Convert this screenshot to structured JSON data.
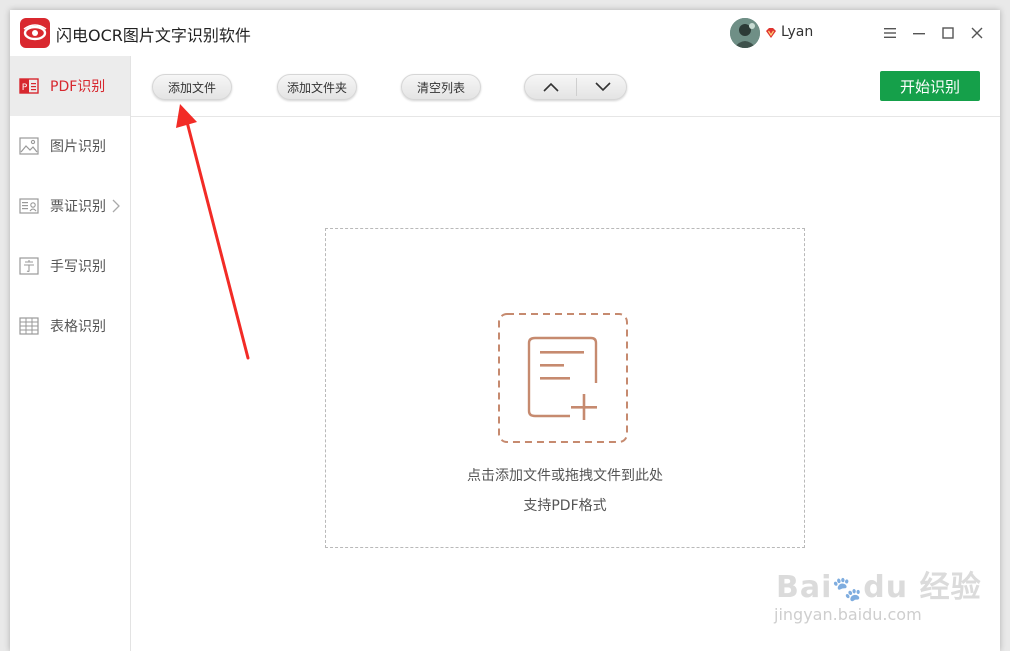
{
  "app": {
    "title": "闪电OCR图片文字识别软件",
    "username": "Lyan",
    "accent_color": "#d7282f",
    "primary_color": "#15a04a"
  },
  "window_controls": {
    "menu_icon": "hamburger-icon",
    "minimize_icon": "minimize-icon",
    "maximize_icon": "maximize-icon",
    "close_icon": "close-icon"
  },
  "sidebar": {
    "items": [
      {
        "label": "PDF识别",
        "icon": "pdf-icon",
        "active": true
      },
      {
        "label": "图片识别",
        "icon": "image-icon",
        "active": false
      },
      {
        "label": "票证识别",
        "icon": "id-card-icon",
        "active": false
      },
      {
        "label": "手写识别",
        "icon": "handwriting-icon",
        "active": false
      },
      {
        "label": "表格识别",
        "icon": "table-icon",
        "active": false
      }
    ]
  },
  "toolbar": {
    "add_file": "添加文件",
    "add_folder": "添加文件夹",
    "clear_list": "清空列表",
    "move_up_icon": "chevron-up-icon",
    "move_down_icon": "chevron-down-icon",
    "start": "开始识别"
  },
  "dropzone": {
    "hint": "点击添加文件或拖拽文件到此处",
    "support": "支持PDF格式",
    "icon": "add-document-icon"
  },
  "watermark": {
    "url": "jingyan.baidu.com"
  }
}
